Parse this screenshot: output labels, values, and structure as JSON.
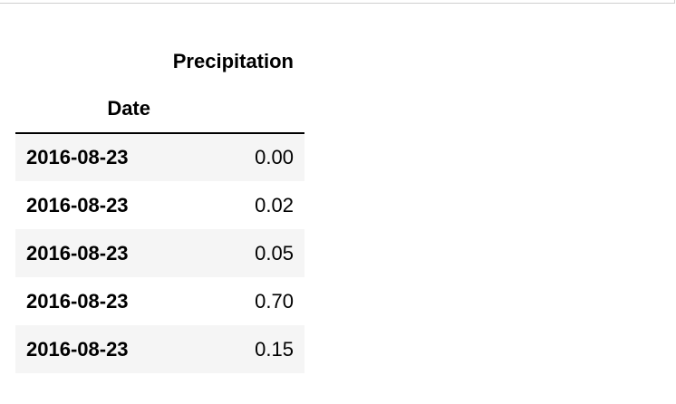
{
  "table": {
    "columns": [
      "Precipitation"
    ],
    "index_name": "Date",
    "rows": [
      {
        "date": "2016-08-23",
        "precipitation": "0.00"
      },
      {
        "date": "2016-08-23",
        "precipitation": "0.02"
      },
      {
        "date": "2016-08-23",
        "precipitation": "0.05"
      },
      {
        "date": "2016-08-23",
        "precipitation": "0.70"
      },
      {
        "date": "2016-08-23",
        "precipitation": "0.15"
      }
    ]
  },
  "colors": {
    "stripe": "#f5f5f5",
    "header_rule": "#000000"
  }
}
